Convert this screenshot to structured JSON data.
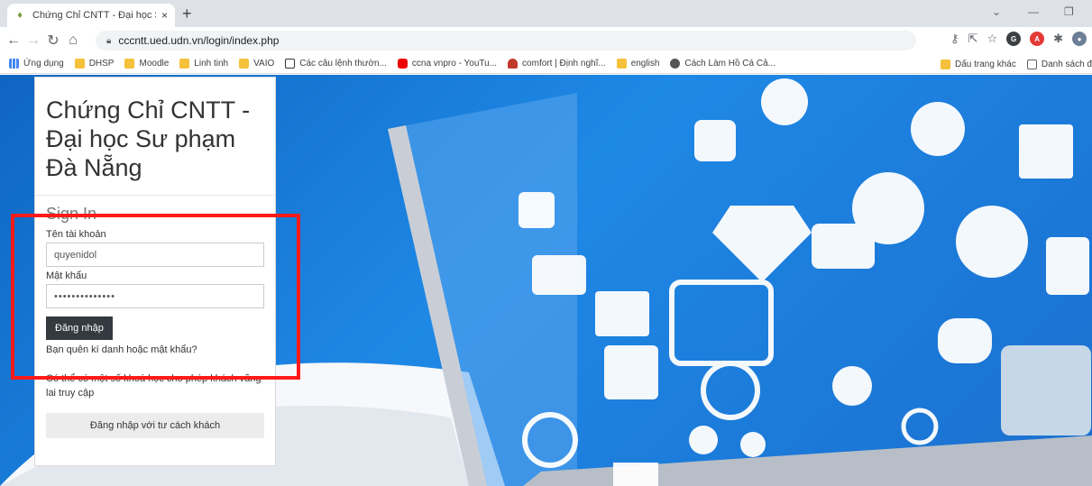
{
  "browser": {
    "tab_title": "Chứng Chỉ CNTT - Đại học Sư ph",
    "tab_close": "×",
    "new_tab": "+",
    "url": "cccntt.ued.udn.vn/login/index.php"
  },
  "bookmarks": {
    "items": [
      {
        "label": "Ứng dụng",
        "icon": "apps-grid-icon"
      },
      {
        "label": "DHSP",
        "icon": "folder-icon"
      },
      {
        "label": "Moodle",
        "icon": "folder-icon"
      },
      {
        "label": "Linh tinh",
        "icon": "folder-icon"
      },
      {
        "label": "VAIO",
        "icon": "folder-icon"
      },
      {
        "label": "Các câu lệnh thườn...",
        "icon": "js-icon"
      },
      {
        "label": "ccna vnpro - YouTu...",
        "icon": "youtube-icon"
      },
      {
        "label": "comfort | Định nghĩ...",
        "icon": "shield-icon"
      },
      {
        "label": "english",
        "icon": "folder-icon"
      },
      {
        "label": "Cách Làm Hồ Cá Cả...",
        "icon": "globe-icon"
      }
    ],
    "other": "Dấu trang khác",
    "reading_list": "Danh sách đ"
  },
  "login": {
    "site_title": "Chứng Chỉ CNTT - Đại học Sư phạm Đà Nẵng",
    "heading": "Sign In",
    "username_label": "Tên tài khoản",
    "username_value": "quyenidol",
    "password_label": "Mật khẩu",
    "password_mask": "••••••••••••••",
    "login_button": "Đăng nhập",
    "forgot_link": "Bạn quên kí danh hoặc mật khẩu?",
    "guest_note": "Có thể có một số khoá học cho phép khách vãng lai truy cập",
    "guest_button": "Đăng nhập với tư cách khách"
  },
  "colors": {
    "highlight": "#ff1a1a",
    "background": "#1e88e5",
    "button": "#343a40"
  }
}
